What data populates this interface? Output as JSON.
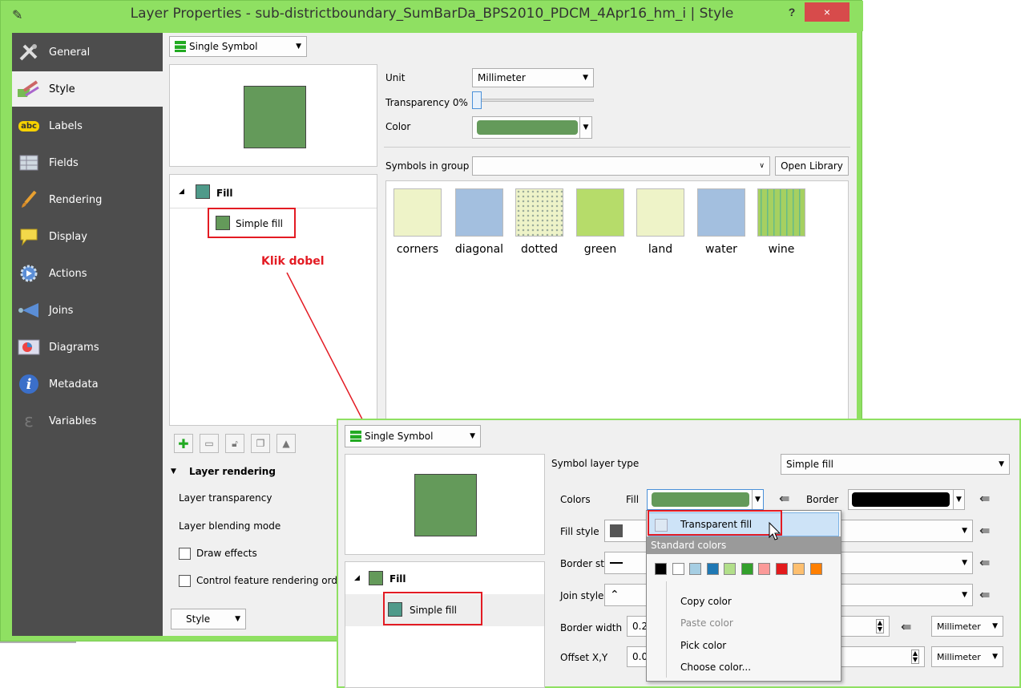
{
  "window": {
    "title": "Layer Properties - sub-districtboundary_SumBarDa_BPS2010_PDCM_4Apr16_hm_i | Style",
    "help": "?",
    "close": "×"
  },
  "sidebar": {
    "items": [
      {
        "label": "General",
        "icon": "tools-icon"
      },
      {
        "label": "Style",
        "icon": "paintbrush-icon"
      },
      {
        "label": "Labels",
        "icon": "abc-label-icon"
      },
      {
        "label": "Fields",
        "icon": "table-icon"
      },
      {
        "label": "Rendering",
        "icon": "brush-icon"
      },
      {
        "label": "Display",
        "icon": "speech-bubble-icon"
      },
      {
        "label": "Actions",
        "icon": "gear-play-icon"
      },
      {
        "label": "Joins",
        "icon": "join-arrow-icon"
      },
      {
        "label": "Diagrams",
        "icon": "diagram-icon"
      },
      {
        "label": "Metadata",
        "icon": "info-icon"
      },
      {
        "label": "Variables",
        "icon": "epsilon-icon"
      }
    ],
    "abc_glyph": "abc",
    "info_glyph": "i",
    "epsilon_glyph": "ε"
  },
  "style": {
    "renderer": "Single Symbol",
    "unit_label": "Unit",
    "unit_value": "Millimeter",
    "transparency_label": "Transparency 0%",
    "transparency": 0,
    "color_label": "Color",
    "symbols_group_label": "Symbols in group",
    "open_library": "Open Library",
    "tree_fill": "Fill",
    "tree_simple_fill": "Simple fill",
    "annotation": "Klik dobel",
    "layer_rendering": "Layer rendering",
    "layer_transparency": "Layer transparency",
    "layer_blending": "Layer blending mode",
    "draw_effects": "Draw effects",
    "control_feature": "Control feature rendering ord",
    "style_button": "Style"
  },
  "library": [
    {
      "label": "corners",
      "color": "#eef3c8"
    },
    {
      "label": "diagonal",
      "color": "#a3bfdf"
    },
    {
      "label": "dotted",
      "color": "#eef3c8"
    },
    {
      "label": "green",
      "color": "#b6dc6a"
    },
    {
      "label": "land",
      "color": "#eef3c8"
    },
    {
      "label": "water",
      "color": "#a3bfdf"
    },
    {
      "label": "wine",
      "color": "#a6d061"
    }
  ],
  "symbol_layer": {
    "renderer": "Single Symbol",
    "type_label": "Symbol layer type",
    "type_value": "Simple fill",
    "colors_label": "Colors",
    "fill_label": "Fill",
    "border_label": "Border",
    "fill_style_label": "Fill style",
    "border_style_label": "Border style",
    "join_style_label": "Join style",
    "border_width_label": "Border width",
    "border_width_value": "0.2",
    "offset_label": "Offset X,Y",
    "offset_value": "0.0",
    "unit": "Millimeter",
    "tree_fill": "Fill",
    "tree_simple_fill": "Simple fill"
  },
  "color_menu": {
    "transparent_fill": "Transparent fill",
    "standard_colors": "Standard colors",
    "swatches": [
      "#000000",
      "#ffffff",
      "#a6cee3",
      "#1f78b4",
      "#b2df8a",
      "#33a02c",
      "#fb9a99",
      "#e31a1c",
      "#fdbf6f",
      "#ff7f00"
    ],
    "copy_color": "Copy color",
    "paste_color": "Paste color",
    "pick_color": "Pick color",
    "choose_color": "Choose color..."
  },
  "colors": {
    "fill": "#649a5a",
    "fill_alt": "#4f9a8a",
    "border": "#000000",
    "accent_red": "#e31b23",
    "window_border": "#8fe062"
  }
}
